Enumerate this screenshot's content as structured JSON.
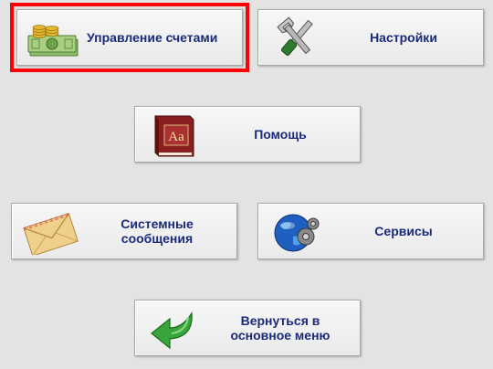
{
  "menu": {
    "accounts_label": "Управление счетами",
    "settings_label": "Настройки",
    "help_label": "Помощь",
    "messages_label": "Системные\nсообщения",
    "services_label": "Сервисы",
    "back_label": "Вернуться в\nосновное меню",
    "selected_item": "accounts",
    "selection_color": "#ff0000",
    "label_color": "#1a2a7a"
  },
  "icons": {
    "accounts": "money-icon",
    "settings": "tools-icon",
    "help": "book-icon",
    "messages": "envelope-icon",
    "services": "globe-icon",
    "back": "back-arrow-icon"
  },
  "help_book_text": "Aa"
}
